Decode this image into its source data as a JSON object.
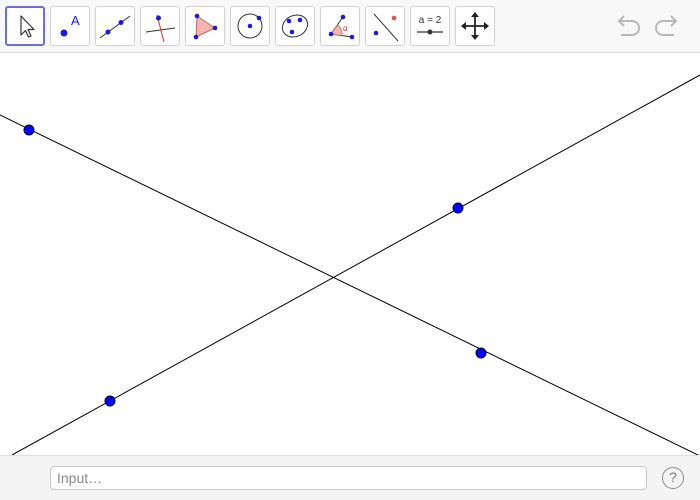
{
  "toolbar": {
    "tools": [
      {
        "name": "move",
        "icon": "arrow-pointer-icon",
        "active": true
      },
      {
        "name": "point",
        "icon": "point-tool-icon",
        "label": "A"
      },
      {
        "name": "line",
        "icon": "line-tool-icon"
      },
      {
        "name": "perpendicular-line",
        "icon": "perpendicular-line-icon"
      },
      {
        "name": "polygon",
        "icon": "polygon-tool-icon"
      },
      {
        "name": "circle-center-point",
        "icon": "circle-tool-icon"
      },
      {
        "name": "ellipse",
        "icon": "ellipse-tool-icon"
      },
      {
        "name": "angle",
        "icon": "angle-tool-icon",
        "label": "α"
      },
      {
        "name": "reflect",
        "icon": "reflect-tool-icon"
      },
      {
        "name": "slider",
        "icon": "slider-tool-icon",
        "label": "a = 2"
      },
      {
        "name": "move-graphics-view",
        "icon": "move-view-icon"
      }
    ],
    "undo_icon": "undo-icon",
    "redo_icon": "redo-icon"
  },
  "input_bar": {
    "placeholder": "Input…",
    "help_label": "?"
  },
  "colors": {
    "accent": "#6b6fd6",
    "point_fill": "#0000ff",
    "line": "#000000",
    "polygon_fill": "#f4b6ae",
    "polygon_stroke": "#c26a60"
  }
}
